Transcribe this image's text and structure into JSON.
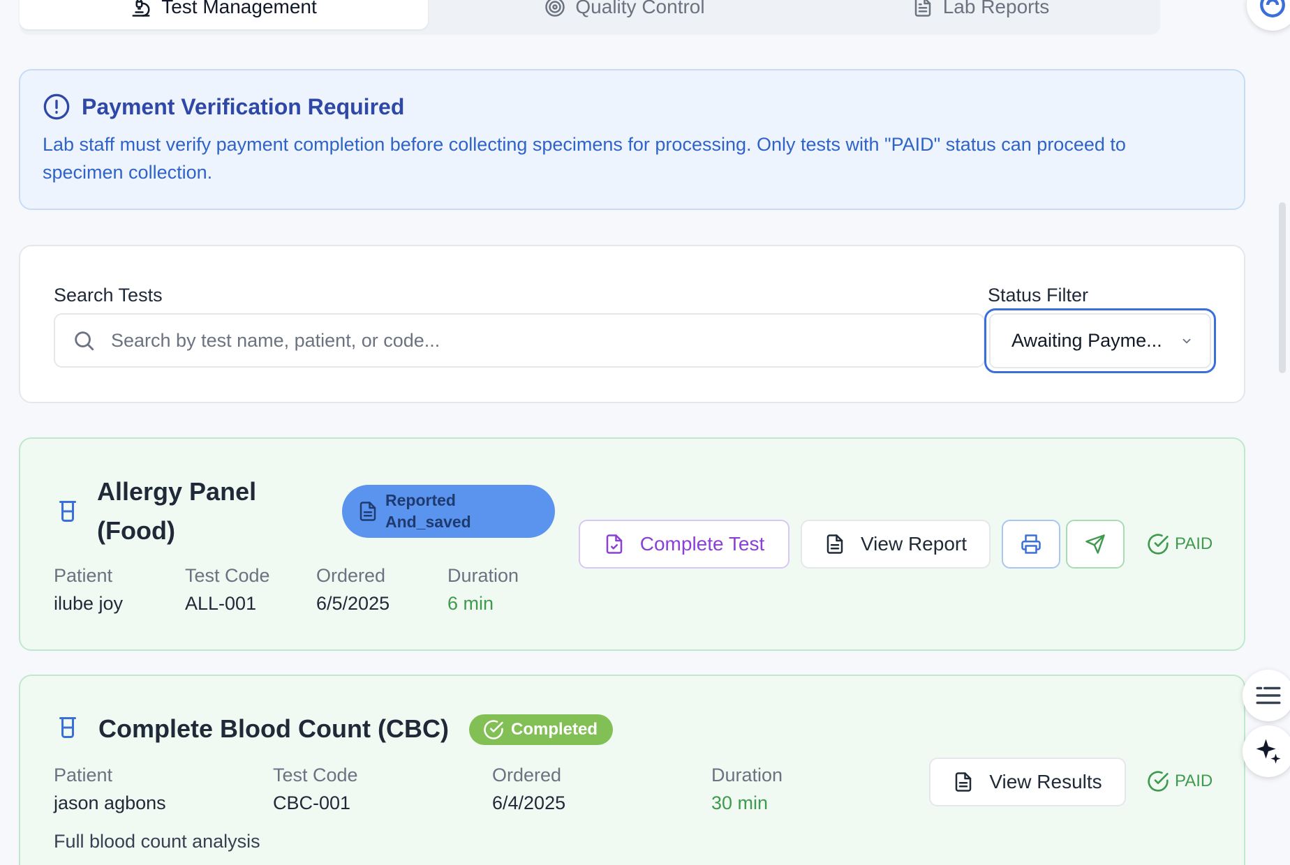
{
  "tabs": [
    {
      "label": "Test Management",
      "icon": "microscope-icon",
      "active": true
    },
    {
      "label": "Quality Control",
      "icon": "target-icon",
      "active": false
    },
    {
      "label": "Lab Reports",
      "icon": "file-text-icon",
      "active": false
    }
  ],
  "alert": {
    "title": "Payment Verification Required",
    "body": "Lab staff must verify payment completion before collecting specimens for processing. Only tests with \"PAID\" status can proceed to specimen collection."
  },
  "filters": {
    "search_label": "Search Tests",
    "search_placeholder": "Search by test name, patient, or code...",
    "status_label": "Status Filter",
    "status_value": "Awaiting Payme..."
  },
  "labels": {
    "patient": "Patient",
    "test_code": "Test Code",
    "ordered": "Ordered",
    "duration": "Duration"
  },
  "tests": [
    {
      "name_line1": "Allergy Panel",
      "name_line2": "(Food)",
      "status_line1": "Reported",
      "status_line2": "And_saved",
      "patient": "ilube joy",
      "code": "ALL-001",
      "ordered": "6/5/2025",
      "duration": "6 min",
      "actions": {
        "complete": "Complete Test",
        "view_report": "View Report"
      },
      "payment": "PAID"
    },
    {
      "name": "Complete Blood Count (CBC)",
      "status": "Completed",
      "patient": "jason agbons",
      "code": "CBC-001",
      "ordered": "6/4/2025",
      "duration": "30 min",
      "description": "Full blood count analysis",
      "actions": {
        "view_results": "View Results"
      },
      "payment": "PAID"
    }
  ],
  "colors": {
    "accent_blue": "#3b6fd8",
    "paid_green": "#3f9a4e",
    "completed_badge": "#82c056",
    "reported_badge": "#5b94ee",
    "complete_purple": "#8b3fd9"
  }
}
